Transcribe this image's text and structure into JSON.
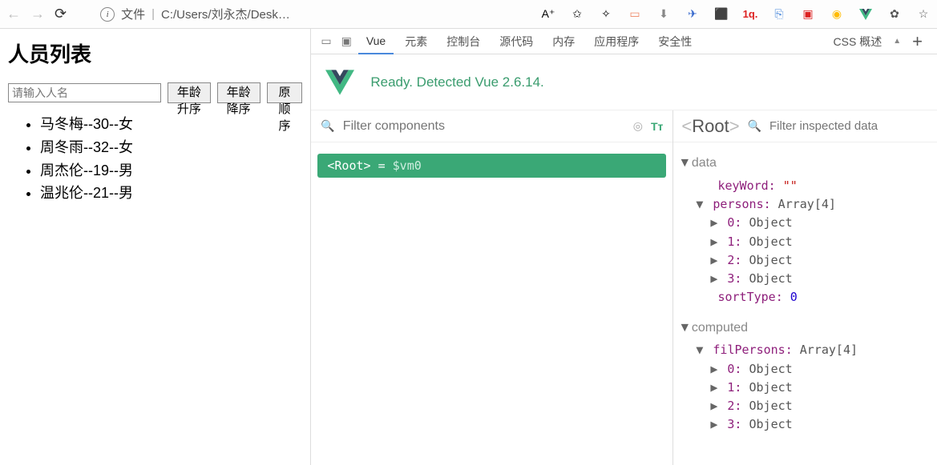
{
  "topbar": {
    "file_label": "文件",
    "url": "C:/Users/刘永杰/Desk…",
    "a_icon": "A⁺"
  },
  "page": {
    "title": "人员列表",
    "input_placeholder": "请输入人名",
    "btn_asc": "年龄升序",
    "btn_desc": "年龄降序",
    "btn_orig": "原顺序",
    "persons": [
      "马冬梅--30--女",
      "周冬雨--32--女",
      "周杰伦--19--男",
      "温兆伦--21--男"
    ]
  },
  "devtabs": {
    "vue": "Vue",
    "elements": "元素",
    "console": "控制台",
    "sources": "源代码",
    "memory": "内存",
    "application": "应用程序",
    "security": "安全性",
    "css": "CSS 概述",
    "beta": "▲"
  },
  "banner": {
    "msg": "Ready. Detected Vue 2.6.14."
  },
  "filter": {
    "placeholder": "Filter components"
  },
  "root_chip": {
    "open": "<Root>",
    "eq": " = ",
    "vm": "$vm0"
  },
  "inspect": {
    "root_open": "<",
    "root_text": "Root",
    "root_close": ">",
    "filter_placeholder": "Filter inspected data"
  },
  "tree": {
    "data_label": "data",
    "keyWord_key": "keyWord:",
    "keyWord_val": "\"\"",
    "persons_key": "persons:",
    "persons_val": "Array[4]",
    "idx0": "0:",
    "idx1": "1:",
    "idx2": "2:",
    "idx3": "3:",
    "obj": "Object",
    "sortType_key": "sortType:",
    "sortType_val": "0",
    "computed_label": "computed",
    "filPersons_key": "filPersons:",
    "filPersons_val": "Array[4]"
  }
}
